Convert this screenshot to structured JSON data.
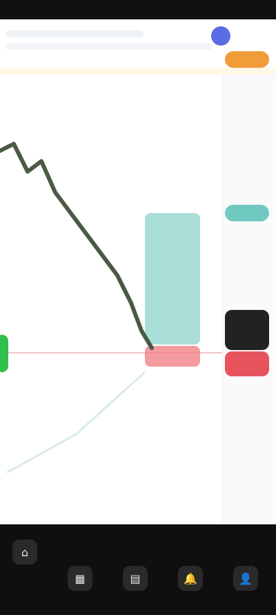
{
  "app": {
    "title": ""
  },
  "header": {
    "line1": "",
    "line2": ""
  },
  "right_axis": {
    "badges": [
      "",
      "",
      "",
      ""
    ]
  },
  "chart": {
    "pair": "",
    "colors": {
      "bg": "#ffffff",
      "line": "#4a5a45",
      "accent_teal": "#6fc9c1",
      "accent_red": "#e6535b",
      "accent_orange": "#f29b39",
      "accent_green": "#2fbf4c"
    }
  },
  "bottom_nav": {
    "items": [
      {
        "icon": "home-icon",
        "label": ""
      },
      {
        "icon": "chart-icon",
        "label": ""
      },
      {
        "icon": "grid-icon",
        "label": ""
      },
      {
        "icon": "bell-icon",
        "label": ""
      },
      {
        "icon": "user-icon",
        "label": ""
      }
    ]
  }
}
